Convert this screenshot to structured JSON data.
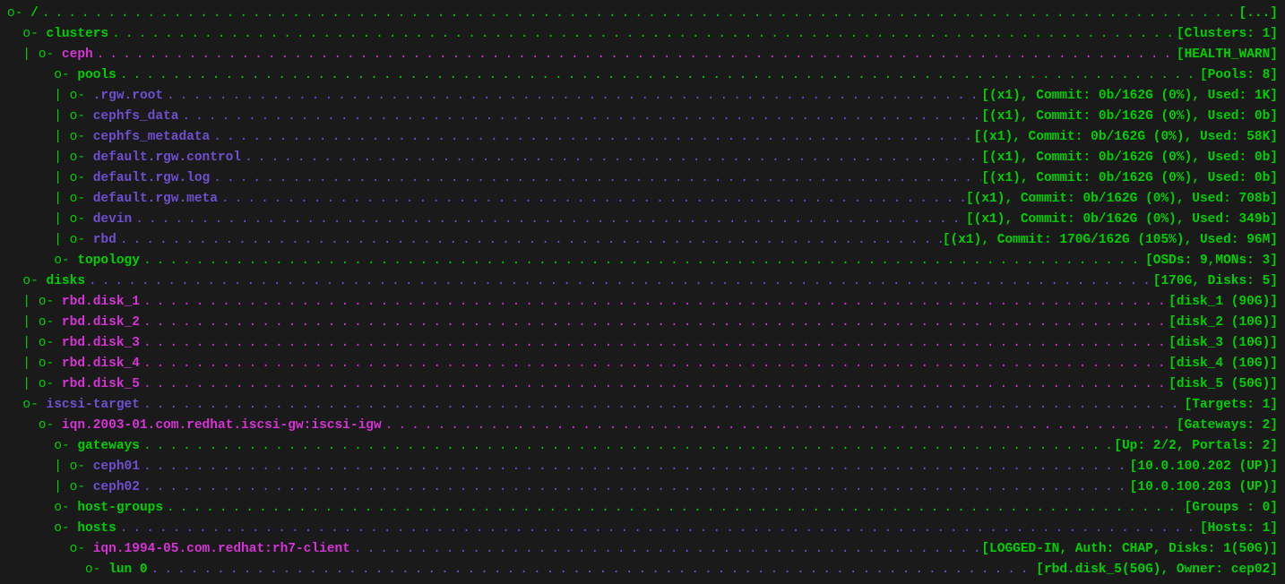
{
  "rows": [
    {
      "indent": "",
      "pfx": "o- ",
      "pfxcol": "green",
      "label": "/",
      "labcol": "green",
      "dots": "green",
      "status": "[...]"
    },
    {
      "indent": "  ",
      "pfx": "o- ",
      "pfxcol": "green",
      "label": "clusters",
      "labcol": "green",
      "dots": "green",
      "status": "[Clusters: 1]"
    },
    {
      "indent": "  | ",
      "pfx": "o- ",
      "pfxcol": "green",
      "label": "ceph",
      "labcol": "magenta",
      "dots": "magenta",
      "status": "[HEALTH_WARN]"
    },
    {
      "indent": "      ",
      "pfx": "o- ",
      "pfxcol": "green",
      "label": "pools",
      "labcol": "green",
      "dots": "green",
      "status": "[Pools: 8]"
    },
    {
      "indent": "      | ",
      "pfx": "o- ",
      "pfxcol": "green",
      "label": ".rgw.root",
      "labcol": "violet",
      "dots": "violet",
      "status": "[(x1), Commit: 0b/162G (0%), Used: 1K]"
    },
    {
      "indent": "      | ",
      "pfx": "o- ",
      "pfxcol": "green",
      "label": "cephfs_data",
      "labcol": "violet",
      "dots": "violet",
      "status": "[(x1), Commit: 0b/162G (0%), Used: 0b]"
    },
    {
      "indent": "      | ",
      "pfx": "o- ",
      "pfxcol": "green",
      "label": "cephfs_metadata",
      "labcol": "violet",
      "dots": "violet",
      "status": "[(x1), Commit: 0b/162G (0%), Used: 58K]"
    },
    {
      "indent": "      | ",
      "pfx": "o- ",
      "pfxcol": "green",
      "label": "default.rgw.control",
      "labcol": "violet",
      "dots": "violet",
      "status": "[(x1), Commit: 0b/162G (0%), Used: 0b]"
    },
    {
      "indent": "      | ",
      "pfx": "o- ",
      "pfxcol": "green",
      "label": "default.rgw.log",
      "labcol": "violet",
      "dots": "violet",
      "status": "[(x1), Commit: 0b/162G (0%), Used: 0b]"
    },
    {
      "indent": "      | ",
      "pfx": "o- ",
      "pfxcol": "green",
      "label": "default.rgw.meta",
      "labcol": "violet",
      "dots": "violet",
      "status": "[(x1), Commit: 0b/162G (0%), Used: 708b]"
    },
    {
      "indent": "      | ",
      "pfx": "o- ",
      "pfxcol": "green",
      "label": "devin",
      "labcol": "violet",
      "dots": "violet",
      "status": "[(x1), Commit: 0b/162G (0%), Used: 349b]"
    },
    {
      "indent": "      | ",
      "pfx": "o- ",
      "pfxcol": "green",
      "label": "rbd",
      "labcol": "violet",
      "dots": "violet",
      "status": "[(x1), Commit: 170G/162G (105%), Used: 96M]"
    },
    {
      "indent": "      ",
      "pfx": "o- ",
      "pfxcol": "green",
      "label": "topology",
      "labcol": "green",
      "dots": "green",
      "status": "[OSDs: 9,MONs: 3]"
    },
    {
      "indent": "  ",
      "pfx": "o- ",
      "pfxcol": "green",
      "label": "disks",
      "labcol": "green",
      "dots": "violet",
      "status": "[170G, Disks: 5]"
    },
    {
      "indent": "  | ",
      "pfx": "o- ",
      "pfxcol": "green",
      "label": "rbd.disk_1",
      "labcol": "magenta",
      "dots": "magenta",
      "status": "[disk_1 (90G)]"
    },
    {
      "indent": "  | ",
      "pfx": "o- ",
      "pfxcol": "green",
      "label": "rbd.disk_2",
      "labcol": "magenta",
      "dots": "magenta",
      "status": "[disk_2 (10G)]"
    },
    {
      "indent": "  | ",
      "pfx": "o- ",
      "pfxcol": "green",
      "label": "rbd.disk_3",
      "labcol": "magenta",
      "dots": "magenta",
      "status": "[disk_3 (10G)]"
    },
    {
      "indent": "  | ",
      "pfx": "o- ",
      "pfxcol": "green",
      "label": "rbd.disk_4",
      "labcol": "magenta",
      "dots": "magenta",
      "status": "[disk_4 (10G)]"
    },
    {
      "indent": "  | ",
      "pfx": "o- ",
      "pfxcol": "green",
      "label": "rbd.disk_5",
      "labcol": "magenta",
      "dots": "magenta",
      "status": "[disk_5 (50G)]"
    },
    {
      "indent": "  ",
      "pfx": "o- ",
      "pfxcol": "green",
      "label": "iscsi-target",
      "labcol": "violet",
      "dots": "violet",
      "status": "[Targets: 1]"
    },
    {
      "indent": "    ",
      "pfx": "o- ",
      "pfxcol": "green",
      "label": "iqn.2003-01.com.redhat.iscsi-gw:iscsi-igw",
      "labcol": "magenta",
      "dots": "magenta",
      "status": "[Gateways: 2]"
    },
    {
      "indent": "      ",
      "pfx": "o- ",
      "pfxcol": "green",
      "label": "gateways",
      "labcol": "green",
      "dots": "green",
      "status": "[Up: 2/2, Portals: 2]"
    },
    {
      "indent": "      | ",
      "pfx": "o- ",
      "pfxcol": "green",
      "label": "ceph01",
      "labcol": "violet",
      "dots": "violet",
      "status": "[10.0.100.202 (UP)]"
    },
    {
      "indent": "      | ",
      "pfx": "o- ",
      "pfxcol": "green",
      "label": "ceph02",
      "labcol": "violet",
      "dots": "violet",
      "status": "[10.0.100.203 (UP)]"
    },
    {
      "indent": "      ",
      "pfx": "o- ",
      "pfxcol": "green",
      "label": "host-groups",
      "labcol": "green",
      "dots": "green",
      "status": "[Groups : 0]"
    },
    {
      "indent": "      ",
      "pfx": "o- ",
      "pfxcol": "green",
      "label": "hosts",
      "labcol": "green",
      "dots": "violet",
      "status": "[Hosts: 1]"
    },
    {
      "indent": "        ",
      "pfx": "o- ",
      "pfxcol": "green",
      "label": "iqn.1994-05.com.redhat:rh7-client",
      "labcol": "magenta",
      "dots": "violet",
      "status": "[LOGGED-IN, Auth: CHAP, Disks: 1(50G)]"
    },
    {
      "indent": "          ",
      "pfx": "o- ",
      "pfxcol": "green",
      "label": "lun 0",
      "labcol": "green",
      "dots": "violet",
      "status": "[rbd.disk_5(50G), Owner: cep02]"
    }
  ]
}
